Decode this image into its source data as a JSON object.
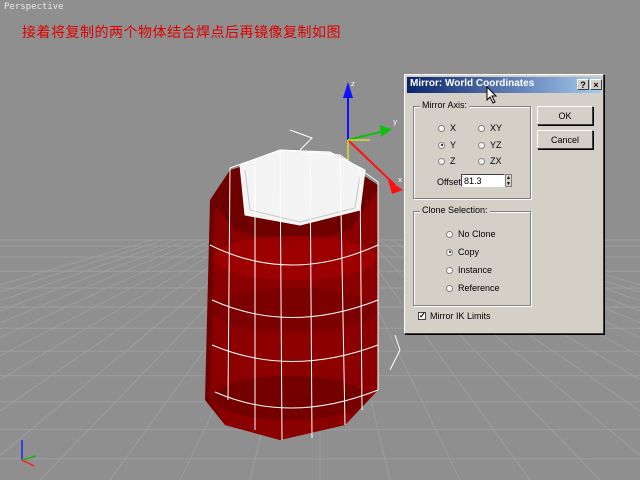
{
  "caption": "接着将复制的两个物体结合焊点后再镜像复制如图",
  "viewport": {
    "label": "Perspective"
  },
  "dialog": {
    "title": "Mirror: World Coordinates",
    "help_button": "?",
    "close_button": "×",
    "mirror_axis": {
      "label": "Mirror Axis:",
      "options": [
        "X",
        "Y",
        "Z",
        "XY",
        "YZ",
        "ZX"
      ],
      "selected": "Y"
    },
    "offset": {
      "label": "Offset:",
      "value": "81.3"
    },
    "clone_selection": {
      "label": "Clone Selection:",
      "options": [
        "No Clone",
        "Copy",
        "Instance",
        "Reference"
      ],
      "selected": "Copy"
    },
    "mirror_ik": {
      "label": "Mirror IK Limits",
      "checked": true
    },
    "ok_label": "OK",
    "cancel_label": "Cancel"
  },
  "colors": {
    "object": "#8b0000",
    "wire": "#ffffff",
    "grid": "#a8a8a8",
    "caption": "#e00000"
  }
}
